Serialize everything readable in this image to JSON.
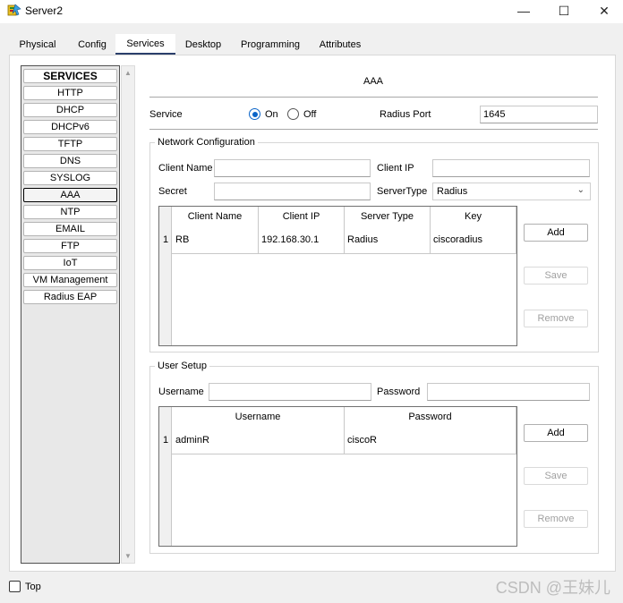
{
  "window": {
    "title": "Server2",
    "minimize_glyph": "—",
    "maximize_glyph": "☐",
    "close_glyph": "✕"
  },
  "tabs": [
    {
      "label": "Physical"
    },
    {
      "label": "Config"
    },
    {
      "label": "Services",
      "active": true
    },
    {
      "label": "Desktop"
    },
    {
      "label": "Programming"
    },
    {
      "label": "Attributes"
    }
  ],
  "services_list": {
    "header": "SERVICES",
    "items": [
      "HTTP",
      "DHCP",
      "DHCPv6",
      "TFTP",
      "DNS",
      "SYSLOG",
      "AAA",
      "NTP",
      "EMAIL",
      "FTP",
      "IoT",
      "VM Management",
      "Radius EAP"
    ],
    "selected": "AAA"
  },
  "aaa": {
    "title": "AAA",
    "service_label": "Service",
    "on_label": "On",
    "off_label": "Off",
    "service_state": "On",
    "radius_port_label": "Radius Port",
    "radius_port_value": "1645",
    "network_config": {
      "title": "Network Configuration",
      "client_name_label": "Client Name",
      "client_name_value": "",
      "client_ip_label": "Client IP",
      "client_ip_value": "",
      "secret_label": "Secret",
      "secret_value": "",
      "server_type_label": "ServerType",
      "server_type_value": "Radius",
      "table": {
        "columns": [
          "Client Name",
          "Client IP",
          "Server Type",
          "Key"
        ],
        "rows": [
          {
            "num": "1",
            "client_name": "RB",
            "client_ip": "192.168.30.1",
            "server_type": "Radius",
            "key": "ciscoradius"
          }
        ]
      },
      "add_label": "Add",
      "save_label": "Save",
      "remove_label": "Remove"
    },
    "user_setup": {
      "title": "User Setup",
      "username_label": "Username",
      "username_value": "",
      "password_label": "Password",
      "password_value": "",
      "table": {
        "columns": [
          "Username",
          "Password"
        ],
        "rows": [
          {
            "num": "1",
            "username": "adminR",
            "password": "ciscoR"
          }
        ]
      },
      "add_label": "Add",
      "save_label": "Save",
      "remove_label": "Remove"
    }
  },
  "footer": {
    "top_label": "Top",
    "top_checked": false
  },
  "watermark": "CSDN @王妹儿",
  "colors": {
    "accent": "#0a64c8",
    "tab_underline": "#2b3f6b"
  }
}
